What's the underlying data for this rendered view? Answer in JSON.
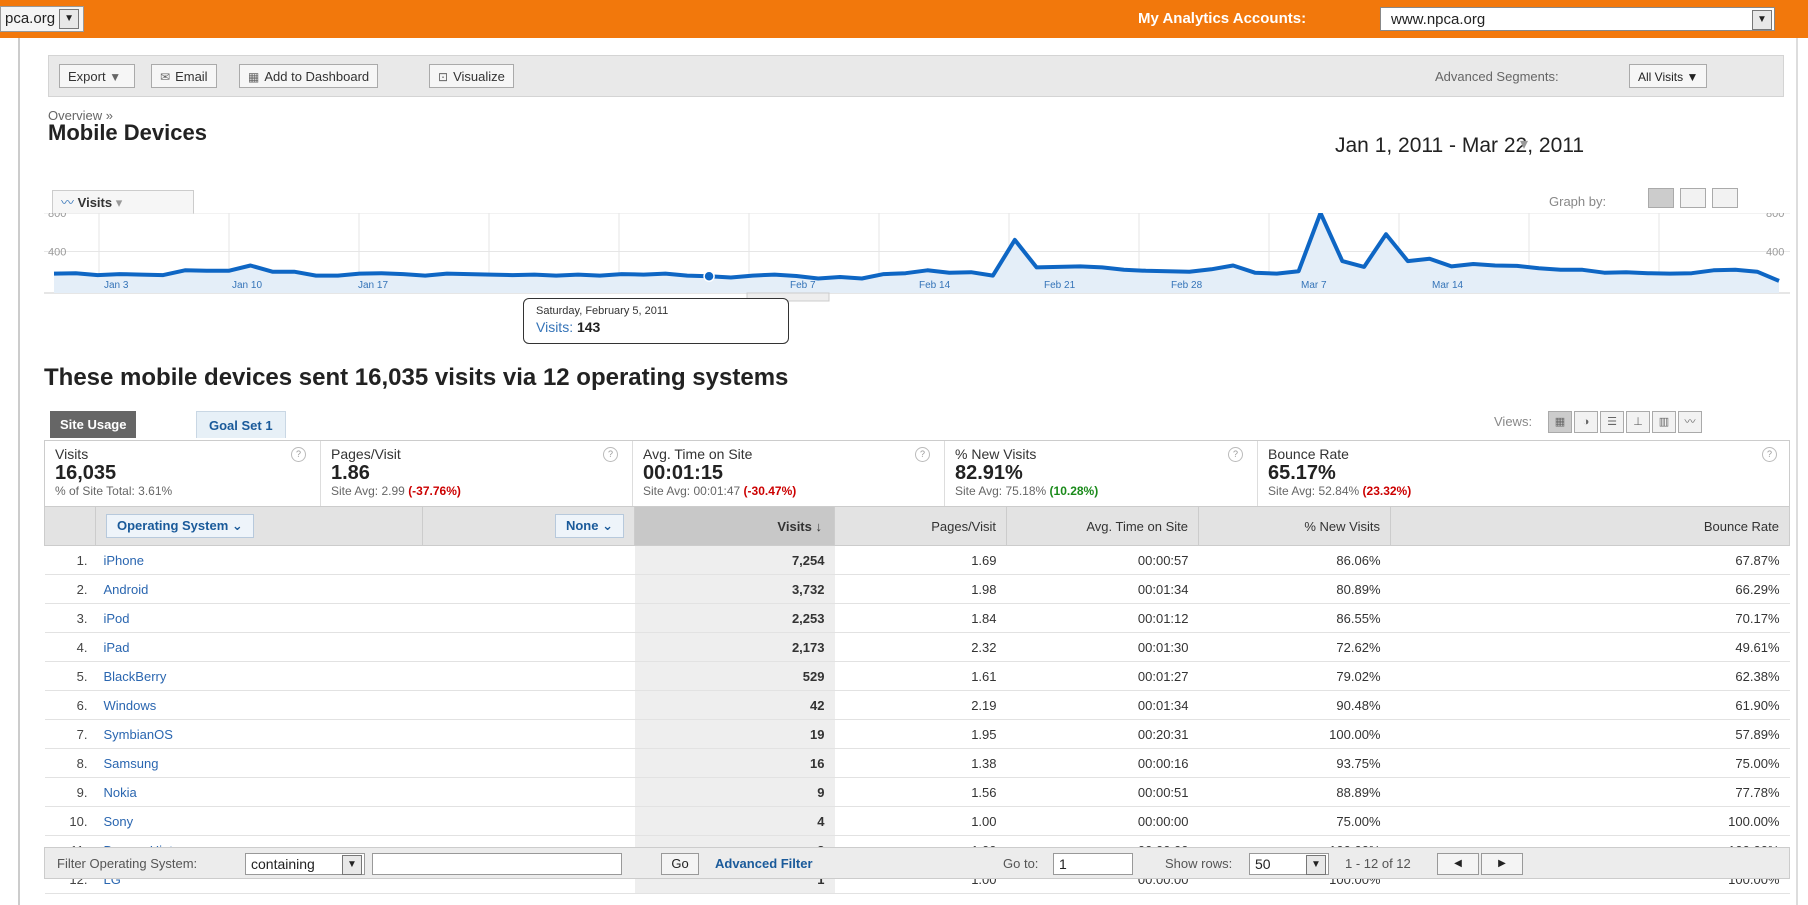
{
  "topbar": {
    "site": "pca.org",
    "accounts_label": "My Analytics Accounts:",
    "account": "www.npca.org",
    "colors": {
      "accent": "#f2780c"
    }
  },
  "toolbar": {
    "export": "Export",
    "email": "Email",
    "dashboard": "Add to Dashboard",
    "visualize": "Visualize",
    "segments_label": "Advanced Segments:",
    "segments_value": "All Visits"
  },
  "header": {
    "breadcrumb": "Overview »",
    "title": "Mobile Devices",
    "date_range": "Jan 1, 2011 - Mar 22, 2011"
  },
  "graph": {
    "metric": "Visits",
    "graph_by_label": "Graph by:",
    "tooltip_date": "Saturday, February 5, 2011",
    "tooltip_label": "Visits:",
    "tooltip_value": "143"
  },
  "chart_data": {
    "type": "area",
    "ylim": [
      0,
      800
    ],
    "y_ticks": [
      400,
      800
    ],
    "x_tick_labels": [
      "Jan 3",
      "Jan 10",
      "Jan 17",
      "Feb 7",
      "Feb 14",
      "Feb 21",
      "Feb 28",
      "Mar 7",
      "Mar 14"
    ],
    "series": [
      {
        "values": [
          170,
          175,
          155,
          165,
          160,
          155,
          205,
          200,
          200,
          255,
          190,
          190,
          150,
          150,
          170,
          175,
          165,
          150,
          170,
          165,
          160,
          155,
          160,
          150,
          160,
          150,
          165,
          160,
          170,
          150,
          143,
          130,
          150,
          160,
          145,
          120,
          135,
          120,
          165,
          175,
          205,
          180,
          185,
          150,
          520,
          235,
          240,
          245,
          235,
          210,
          200,
          195,
          190,
          215,
          255,
          180,
          170,
          195,
          800,
          300,
          240,
          580,
          300,
          325,
          245,
          270,
          255,
          250,
          225,
          210,
          210,
          180,
          185,
          175,
          170,
          175,
          205,
          210,
          190,
          95
        ]
      }
    ]
  },
  "headline": "These mobile devices sent 16,035 visits via 12 operating systems",
  "tabs": {
    "usage": "Site Usage",
    "goal": "Goal Set 1",
    "views_label": "Views:"
  },
  "scorecards": [
    {
      "title": "Visits",
      "value": "16,035",
      "sub": "% of Site Total: 3.61%",
      "delta": ""
    },
    {
      "title": "Pages/Visit",
      "value": "1.86",
      "sub": "Site Avg: 2.99",
      "delta": "(-37.76%)"
    },
    {
      "title": "Avg. Time on Site",
      "value": "00:01:15",
      "sub": "Site Avg: 00:01:47",
      "delta": "(-30.47%)"
    },
    {
      "title": "% New Visits",
      "value": "82.91%",
      "sub": "Site Avg: 75.18%",
      "delta": "(10.28%)"
    },
    {
      "title": "Bounce Rate",
      "value": "65.17%",
      "sub": "Site Avg: 52.84%",
      "delta": "(23.32%)"
    }
  ],
  "table": {
    "dim1": "Operating System",
    "dim2": "None",
    "columns": [
      "Visits",
      "Pages/Visit",
      "Avg. Time on Site",
      "% New Visits",
      "Bounce Rate"
    ],
    "visits_arrow": "↓",
    "rows": [
      {
        "idx": "1.",
        "name": "iPhone",
        "visits": "7,254",
        "ppv": "1.69",
        "time": "00:00:57",
        "new": "86.06%",
        "bounce": "67.87%"
      },
      {
        "idx": "2.",
        "name": "Android",
        "visits": "3,732",
        "ppv": "1.98",
        "time": "00:01:34",
        "new": "80.89%",
        "bounce": "66.29%"
      },
      {
        "idx": "3.",
        "name": "iPod",
        "visits": "2,253",
        "ppv": "1.84",
        "time": "00:01:12",
        "new": "86.55%",
        "bounce": "70.17%"
      },
      {
        "idx": "4.",
        "name": "iPad",
        "visits": "2,173",
        "ppv": "2.32",
        "time": "00:01:30",
        "new": "72.62%",
        "bounce": "49.61%"
      },
      {
        "idx": "5.",
        "name": "BlackBerry",
        "visits": "529",
        "ppv": "1.61",
        "time": "00:01:27",
        "new": "79.02%",
        "bounce": "62.38%"
      },
      {
        "idx": "6.",
        "name": "Windows",
        "visits": "42",
        "ppv": "2.19",
        "time": "00:01:34",
        "new": "90.48%",
        "bounce": "61.90%"
      },
      {
        "idx": "7.",
        "name": "SymbianOS",
        "visits": "19",
        "ppv": "1.95",
        "time": "00:20:31",
        "new": "100.00%",
        "bounce": "57.89%"
      },
      {
        "idx": "8.",
        "name": "Samsung",
        "visits": "16",
        "ppv": "1.38",
        "time": "00:00:16",
        "new": "93.75%",
        "bounce": "75.00%"
      },
      {
        "idx": "9.",
        "name": "Nokia",
        "visits": "9",
        "ppv": "1.56",
        "time": "00:00:51",
        "new": "88.89%",
        "bounce": "77.78%"
      },
      {
        "idx": "10.",
        "name": "Sony",
        "visits": "4",
        "ppv": "1.00",
        "time": "00:00:00",
        "new": "75.00%",
        "bounce": "100.00%"
      },
      {
        "idx": "11.",
        "name": "Danger Hiptop",
        "visits": "3",
        "ppv": "1.00",
        "time": "00:00:00",
        "new": "100.00%",
        "bounce": "100.00%"
      },
      {
        "idx": "12.",
        "name": "LG",
        "visits": "1",
        "ppv": "1.00",
        "time": "00:00:00",
        "new": "100.00%",
        "bounce": "100.00%"
      }
    ]
  },
  "footer": {
    "filter_label": "Filter Operating System:",
    "filter_mode": "containing",
    "filter_value": "",
    "go": "Go",
    "advanced_filter": "Advanced Filter",
    "goto_label": "Go to:",
    "goto_value": "1",
    "rows_label": "Show rows:",
    "rows_value": "50",
    "range": "1 - 12 of 12"
  }
}
